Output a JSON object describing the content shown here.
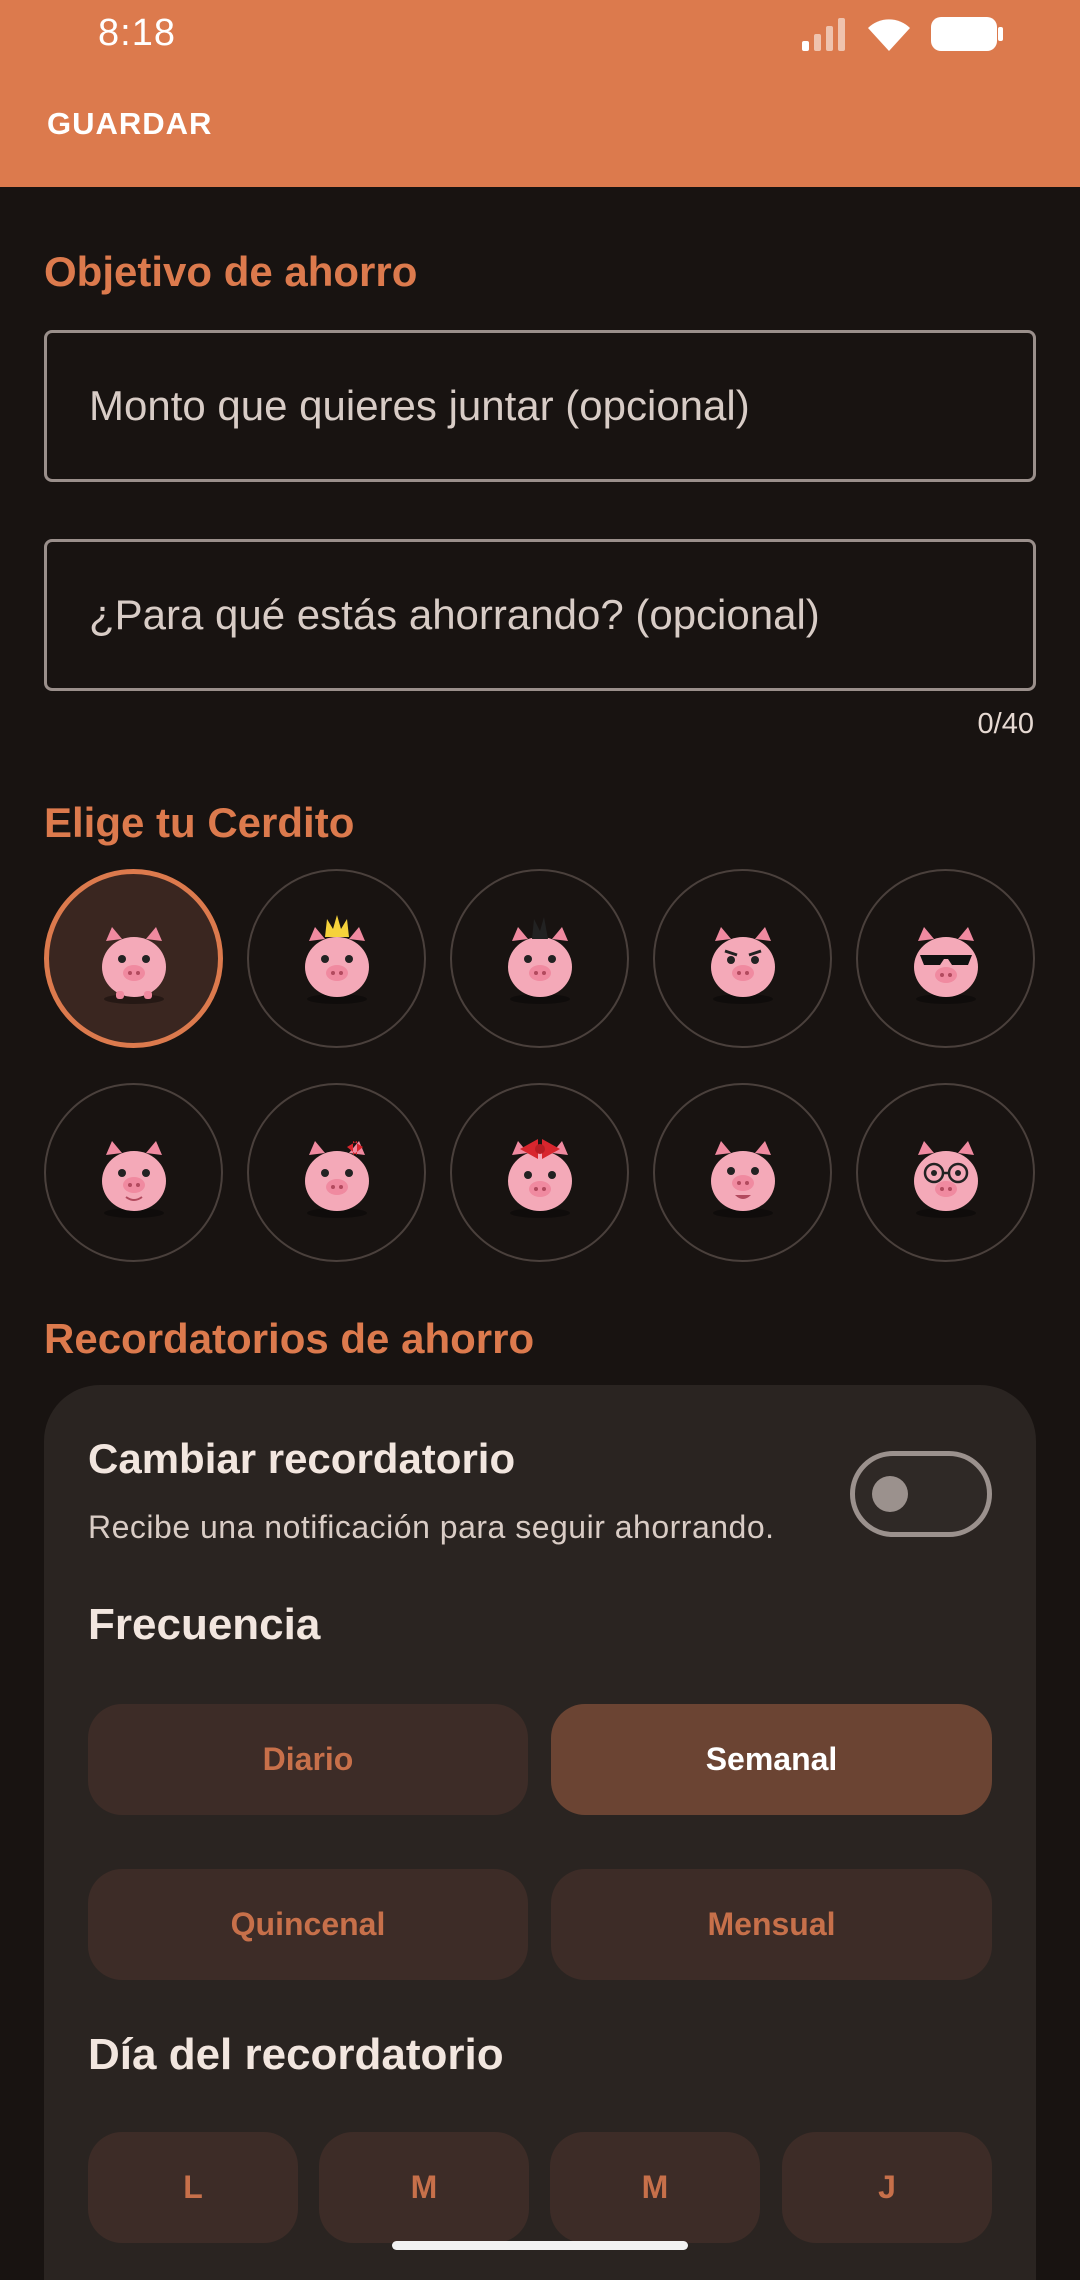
{
  "status": {
    "time": "8:18",
    "icons": [
      "signal-icon",
      "wifi-icon",
      "battery-icon"
    ]
  },
  "topbar": {
    "save_label": "GUARDAR",
    "color": "#dc7a4d"
  },
  "goal": {
    "title": "Objetivo de ahorro",
    "amount_placeholder": "Monto que quieres juntar (opcional)",
    "purpose_placeholder": "¿Para qué estás ahorrando? (opcional)",
    "counter": "0/40"
  },
  "pig_picker": {
    "title": "Elige tu Cerdito",
    "pigs": [
      {
        "name": "pig-plain",
        "selected": true
      },
      {
        "name": "pig-crown"
      },
      {
        "name": "pig-mohawk"
      },
      {
        "name": "pig-angry"
      },
      {
        "name": "pig-sunglasses"
      },
      {
        "name": "pig-smiling"
      },
      {
        "name": "pig-small-bow"
      },
      {
        "name": "pig-big-bow"
      },
      {
        "name": "pig-happy"
      },
      {
        "name": "pig-glasses"
      }
    ]
  },
  "reminders": {
    "title": "Recordatorios de ahorro",
    "toggle_title": "Cambiar recordatorio",
    "toggle_subtitle": "Recibe una notificación para seguir ahorrando.",
    "toggle_on": false,
    "frequency_title": "Frecuencia",
    "frequencies": [
      {
        "label": "Diario",
        "selected": false
      },
      {
        "label": "Semanal",
        "selected": true
      },
      {
        "label": "Quincenal",
        "selected": false
      },
      {
        "label": "Mensual",
        "selected": false
      }
    ],
    "day_title": "Día del recordatorio",
    "days": [
      "L",
      "M",
      "M",
      "J"
    ]
  }
}
